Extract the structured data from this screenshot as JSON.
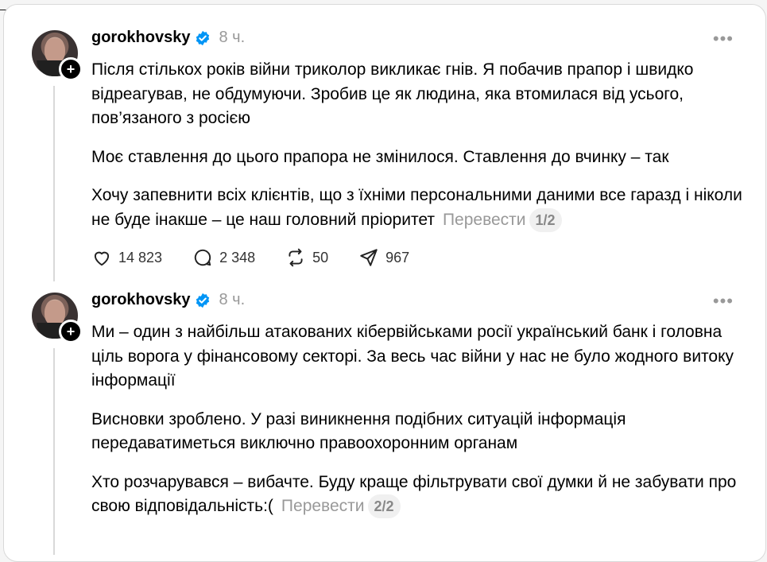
{
  "posts": [
    {
      "username": "gorokhovsky",
      "time": "8 ч.",
      "paragraphs": [
        "Після стількох років війни триколор викликає гнів. Я побачив прапор і швидко відреагував, не обдумуючи. Зробив це як людина, яка втомилася від усього, пов’язаного з росією",
        "Моє ставлення до цього прапора не змінилося. Ставлення до вчинку – так",
        "Хочу запевнити всіх клієнтів, що з їхніми персональними даними все гаразд і ніколи не буде інакше – це наш головний пріоритет"
      ],
      "translate_label": "Перевести",
      "page_indicator": "1/2",
      "likes": "14 823",
      "comments": "2 348",
      "reposts": "50",
      "shares": "967"
    },
    {
      "username": "gorokhovsky",
      "time": "8 ч.",
      "paragraphs": [
        "Ми – один з найбільш атакованих кібервійськами росії український банк і головна ціль ворога у фінансовому секторі. За весь час війни у нас не було жодного витоку інформації",
        "Висновки зроблено. У разі виникнення подібних ситуацій інформація передаватиметься виключно правоохоронним органам",
        "Хто розчарувався – вибачте. Буду краще фільтрувати свої думки й не забувати про свою відповідальність:("
      ],
      "translate_label": "Перевести",
      "page_indicator": "2/2"
    }
  ],
  "colors": {
    "verified": "#0095f6",
    "muted": "#999999"
  },
  "icons": [
    "verified-badge-icon",
    "plus-icon",
    "more-icon",
    "heart-icon",
    "comment-icon",
    "repost-icon",
    "share-icon"
  ]
}
